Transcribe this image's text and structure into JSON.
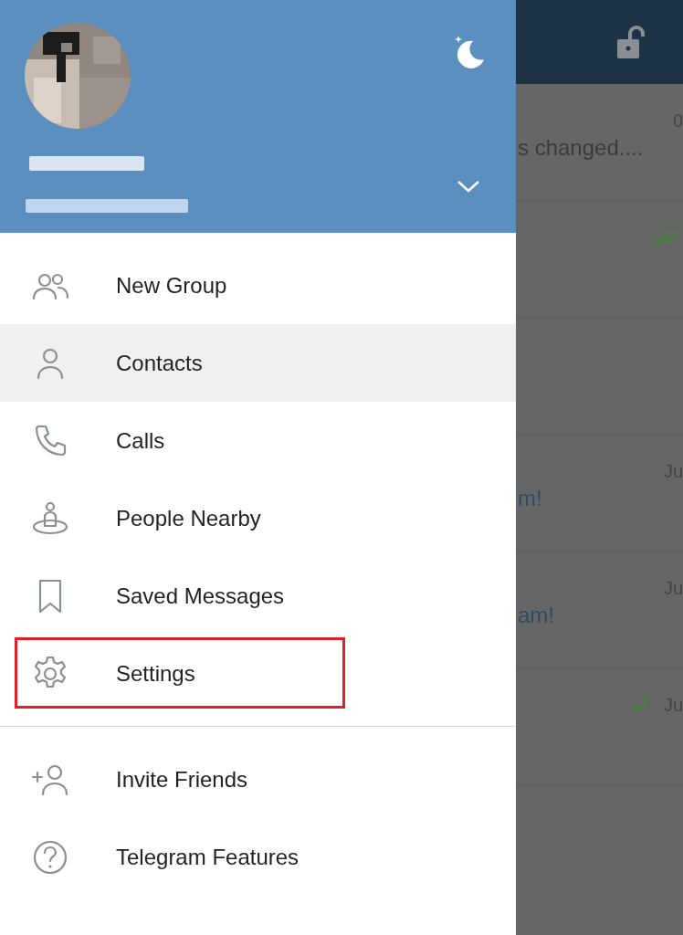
{
  "drawer": {
    "items": [
      {
        "label": "New Group",
        "selected": false,
        "highlighted": false
      },
      {
        "label": "Contacts",
        "selected": true,
        "highlighted": false
      },
      {
        "label": "Calls",
        "selected": false,
        "highlighted": false
      },
      {
        "label": "People Nearby",
        "selected": false,
        "highlighted": false
      },
      {
        "label": "Saved Messages",
        "selected": false,
        "highlighted": false
      },
      {
        "label": "Settings",
        "selected": false,
        "highlighted": true
      },
      {
        "kind": "divider"
      },
      {
        "label": "Invite Friends",
        "selected": false,
        "highlighted": false
      },
      {
        "label": "Telegram Features",
        "selected": false,
        "highlighted": false
      }
    ]
  },
  "chat_list": {
    "rows": [
      {
        "kind": "plain",
        "time": "0",
        "preview": "s changed...."
      },
      {
        "kind": "read"
      },
      {
        "kind": "plain"
      },
      {
        "kind": "plain",
        "time": "Ju",
        "preview": "m!"
      },
      {
        "kind": "plain",
        "time": "Ju",
        "preview": "am!"
      },
      {
        "kind": "sent",
        "time": "Ju"
      }
    ]
  }
}
